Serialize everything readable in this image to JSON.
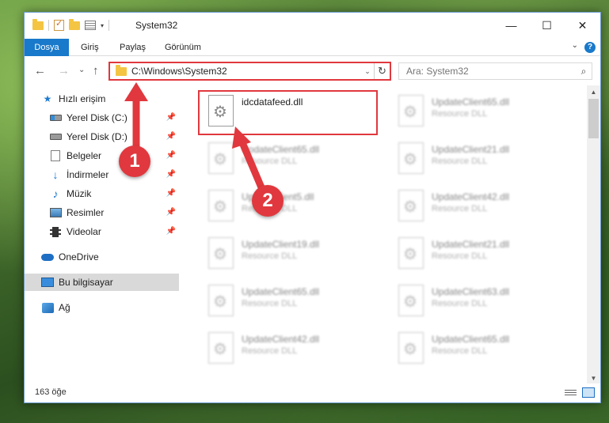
{
  "window": {
    "title": "System32",
    "controls": {
      "minimize": "—",
      "maximize": "☐",
      "close": "✕"
    }
  },
  "ribbon": {
    "tabs": [
      "Dosya",
      "Giriş",
      "Paylaş",
      "Görünüm"
    ],
    "help": "?"
  },
  "nav": {
    "back": "←",
    "forward": "→",
    "recent": "⌄",
    "up": "↑",
    "address": "C:\\Windows\\System32",
    "search_placeholder": "Ara: System32"
  },
  "sidebar": {
    "items": [
      {
        "label": "Hızlı erişim",
        "icon": "star-icon"
      },
      {
        "label": "Yerel Disk (C:)",
        "icon": "drive-c-icon",
        "pinned": true
      },
      {
        "label": "Yerel Disk (D:)",
        "icon": "drive-d-icon",
        "pinned": true
      },
      {
        "label": "Belgeler",
        "icon": "documents-icon",
        "pinned": true
      },
      {
        "label": "İndirmeler",
        "icon": "downloads-icon",
        "pinned": true
      },
      {
        "label": "Müzik",
        "icon": "music-icon",
        "pinned": true
      },
      {
        "label": "Resimler",
        "icon": "pictures-icon",
        "pinned": true
      },
      {
        "label": "Videolar",
        "icon": "videos-icon",
        "pinned": true
      },
      {
        "label": "OneDrive",
        "icon": "onedrive-icon"
      },
      {
        "label": "Bu bilgisayar",
        "icon": "this-pc-icon",
        "selected": true
      },
      {
        "label": "Ağ",
        "icon": "network-icon"
      }
    ]
  },
  "files": [
    {
      "name": "idcdatafeed.dll",
      "type": ""
    },
    {
      "name": "UpdateClient65.dll",
      "type": "Resource DLL"
    },
    {
      "name": "UpdateClient65.dll",
      "type": "Resource DLL"
    },
    {
      "name": "UpdateClient21.dll",
      "type": "Resource DLL"
    },
    {
      "name": "UpdateClient5.dll",
      "type": "Resource DLL"
    },
    {
      "name": "UpdateClient42.dll",
      "type": "Resource DLL"
    },
    {
      "name": "UpdateClient19.dll",
      "type": "Resource DLL"
    },
    {
      "name": "UpdateClient21.dll",
      "type": "Resource DLL"
    },
    {
      "name": "UpdateClient65.dll",
      "type": "Resource DLL"
    },
    {
      "name": "UpdateClient63.dll",
      "type": "Resource DLL"
    },
    {
      "name": "UpdateClient42.dll",
      "type": "Resource DLL"
    },
    {
      "name": "UpdateClient65.dll",
      "type": "Resource DLL"
    }
  ],
  "status": {
    "item_count": "163 öğe"
  },
  "annotations": {
    "marker_1": "1",
    "marker_2": "2",
    "accent_color": "#e0383e"
  }
}
